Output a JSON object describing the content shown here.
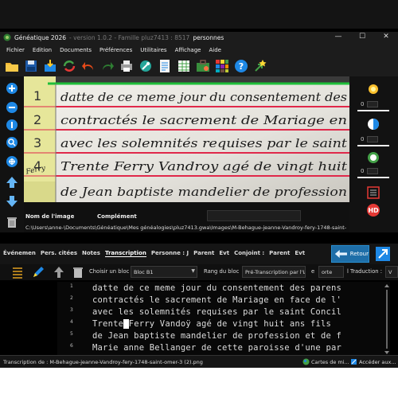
{
  "window": {
    "title": "Généatique 2026",
    "version": " - version 1.0.2 - Famille pluz7413 : 8517",
    "count_suffix": "personnes",
    "minimize": "—",
    "maximize": "☐",
    "close": "✕"
  },
  "menu": [
    "Fichier",
    "Edition",
    "Documents",
    "Préférences",
    "Utilitaires",
    "Affichage",
    "Aide"
  ],
  "toolbar_icons": [
    "folder-open-icon",
    "save-icon",
    "import-icon",
    "sync-icon",
    "undo-icon",
    "redo-icon",
    "print-icon",
    "tools-icon",
    "document-icon",
    "spreadsheet-icon",
    "briefcase-icon",
    "palette-icon",
    "help-icon",
    "goto-icon"
  ],
  "left_tools": [
    "zoom-in-icon",
    "zoom-out-icon",
    "zoom-fit-icon",
    "zoom-search-icon",
    "zoom-all-icon",
    "arrow-up-icon",
    "arrow-down-icon",
    "trash-icon"
  ],
  "right_tools": {
    "brightness_value": "0",
    "contrast_value": "0",
    "color_value": "0",
    "hd_label": "HD"
  },
  "image_lines": [
    {
      "n": "1",
      "text": "datte de ce meme jour du consentement des"
    },
    {
      "n": "2",
      "text": "contractés le sacrement de Mariage en"
    },
    {
      "n": "3",
      "text": "avec les solemnités requises par le saint"
    },
    {
      "n": "4",
      "text": "Trente Ferry Vandroy agé de vingt huit"
    },
    {
      "n": "",
      "text": "de Jean baptiste mandelier de profession"
    }
  ],
  "margin_note": "Ferry",
  "image_info": {
    "name_label": "Nom de l'image",
    "complement_label": "Complément",
    "path": "C:\\Users\\anne-\\Documents\\Généatique\\Mes généalogies\\pluz7413.gwa\\Images\\M-Behague-jeanne-Vandroy-fery-1748-saint-"
  },
  "tabs": [
    {
      "label": "Événemen",
      "active": false
    },
    {
      "label": "Pers. citées",
      "active": false
    },
    {
      "label": "Notes",
      "active": false
    },
    {
      "label": "Transcription",
      "active": true
    },
    {
      "label": "Personne : J",
      "active": false
    },
    {
      "label": "Parent",
      "active": false
    },
    {
      "label": "Evt",
      "active": false
    },
    {
      "label": "Conjoint :",
      "active": false
    },
    {
      "label": "Parent",
      "active": false
    },
    {
      "label": "Evt",
      "active": false
    }
  ],
  "retour_label": "Retour",
  "controls": {
    "bloc_label": "Choisir un bloc :",
    "bloc_value": "Bloc B1",
    "rang_label": "Rang du bloc",
    "pre_transcription": "Pré-Transcription par l'IA",
    "e_label": "e",
    "porte_label": "orte",
    "traduction_label": "l Traduction :",
    "v_label": "V"
  },
  "transcription": [
    {
      "n": "1",
      "text": "datte de ce meme jour du consentement des parens"
    },
    {
      "n": "2",
      "text": "contractés le sacrement de Mariage en face de l'"
    },
    {
      "n": "3",
      "text": "avec les solemnités requises par le saint Concil"
    },
    {
      "n": "4",
      "before": "Trente",
      "caret": " ",
      "after": "Ferry Vandoÿ agé de vingt huit ans fils"
    },
    {
      "n": "5",
      "text": "de Jean baptiste mandelier de profession et de f"
    },
    {
      "n": "6",
      "text": "Marie anne Bellanger de cette paroisse d'une par"
    }
  ],
  "status": {
    "left": "Transcription de : M-Behague-jeanne-Vandroy-fery-1748-saint-omer-3 (2).png",
    "maps": "Cartes de mi...",
    "access": "Accéder aux..."
  }
}
